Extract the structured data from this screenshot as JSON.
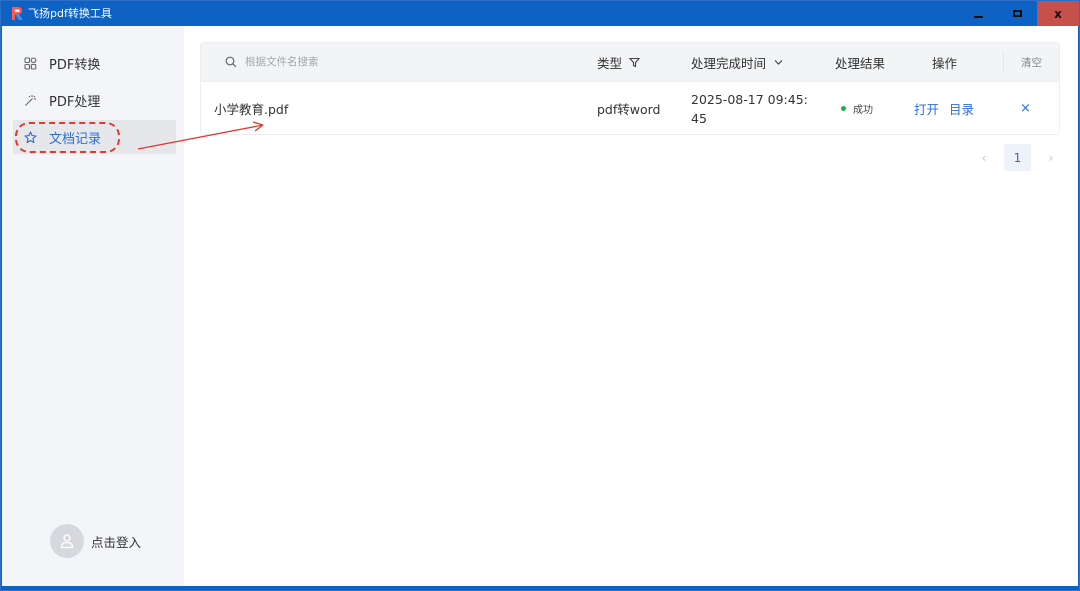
{
  "window": {
    "title": "飞扬pdf转换工具",
    "controls": {
      "minimize": "_",
      "maximize": "□",
      "close": "x"
    }
  },
  "sidebar": {
    "items": [
      {
        "label": "PDF转换",
        "icon": "grid-icon",
        "active": false
      },
      {
        "label": "PDF处理",
        "icon": "magic-wand-icon",
        "active": false
      },
      {
        "label": "文档记录",
        "icon": "star-icon",
        "active": true
      }
    ],
    "login_label": "点击登入"
  },
  "table": {
    "search_placeholder": "根据文件名搜索",
    "headers": {
      "type": "类型",
      "time": "处理完成时间",
      "result": "处理结果",
      "ops": "操作",
      "clear": "清空"
    },
    "rows": [
      {
        "name": "小学教育.pdf",
        "type": "pdf转word",
        "time": "2025-08-17 09:45:45",
        "result": "成功",
        "open": "打开",
        "toc": "目录",
        "delete": "×"
      }
    ]
  },
  "pagination": {
    "current": "1",
    "prev": "‹",
    "next": "›"
  },
  "colors": {
    "accent": "#2b6fd6",
    "titlebar": "#0e62c4",
    "success": "#1bb24b",
    "annotation": "#e23a2f"
  }
}
